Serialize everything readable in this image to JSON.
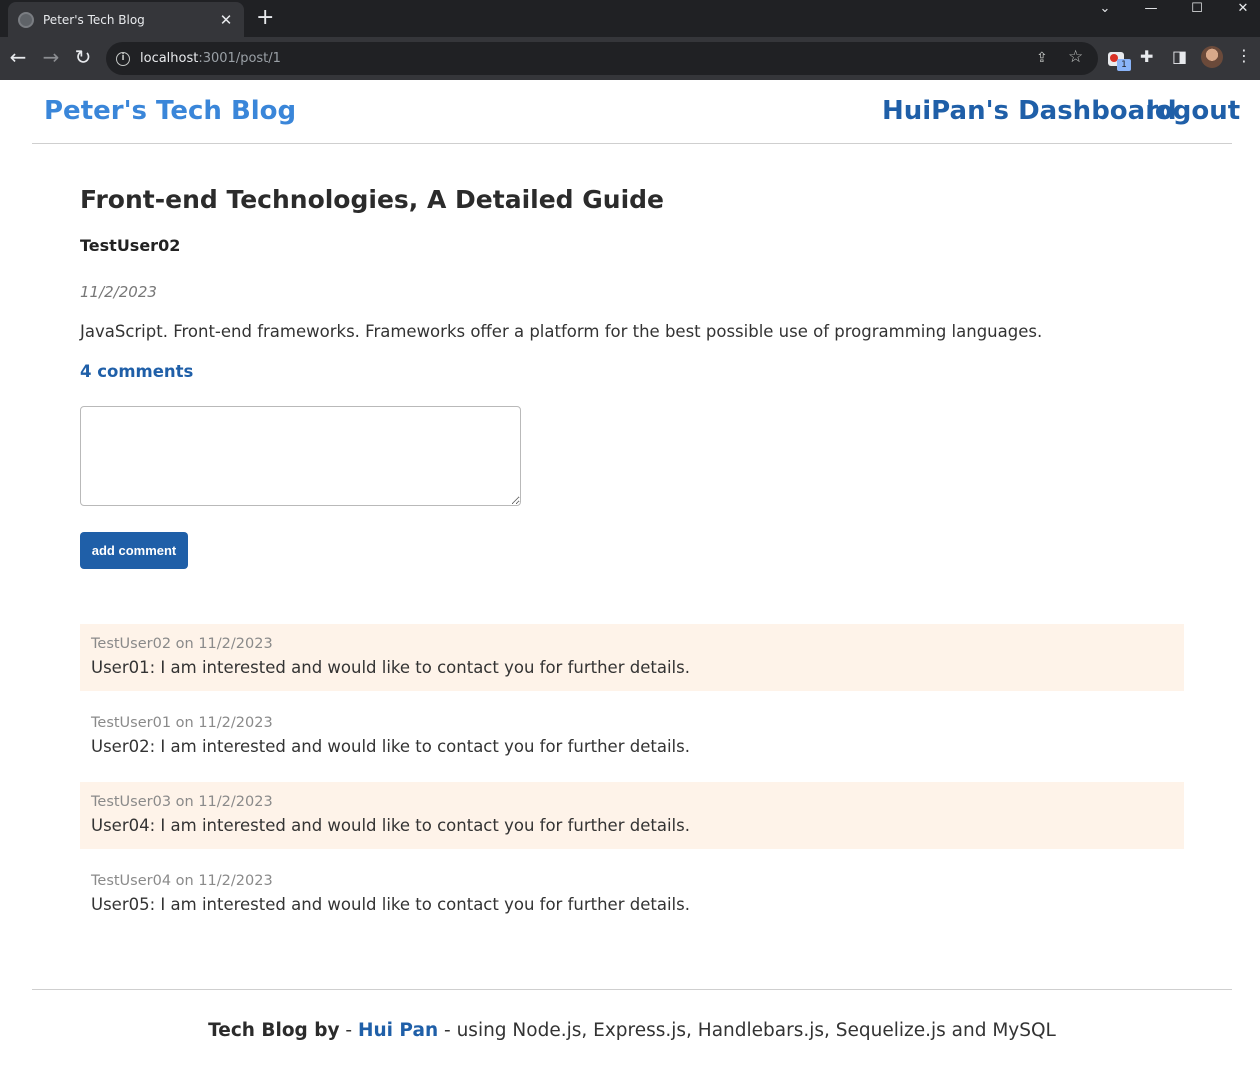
{
  "browser": {
    "tab_title": "Peter's Tech Blog",
    "url_host": "localhost",
    "url_path": ":3001/post/1",
    "extension_badge": "1"
  },
  "site": {
    "title": "Peter's Tech Blog",
    "nav": {
      "dashboard": "HuiPan's Dashboard",
      "logout": "logout"
    }
  },
  "post": {
    "title": "Front-end Technologies, A Detailed Guide",
    "author": "TestUser02",
    "date": "11/2/2023",
    "body": "JavaScript. Front-end frameworks. Frameworks offer a platform for the best possible use of programming languages.",
    "comments_count": "4 comments"
  },
  "comment_form": {
    "value": "",
    "button_label": "add comment"
  },
  "comments": [
    {
      "meta": "TestUser02 on 11/2/2023",
      "text": "User01: I am interested and would like to contact you for further details."
    },
    {
      "meta": "TestUser01 on 11/2/2023",
      "text": "User02: I am interested and would like to contact you for further details."
    },
    {
      "meta": "TestUser03 on 11/2/2023",
      "text": "User04: I am interested and would like to contact you for further details."
    },
    {
      "meta": "TestUser04 on 11/2/2023",
      "text": "User05: I am interested and would like to contact you for further details."
    }
  ],
  "footer": {
    "by": "Tech Blog by",
    "sep1": " - ",
    "author": "Hui Pan",
    "tech": " - using Node.js, Express.js, Handlebars.js, Sequelize.js and MySQL"
  },
  "colors": {
    "brand_light": "#3a86d9",
    "brand_dark": "#1f5fa8",
    "comment_shade": "#fef3e9"
  }
}
